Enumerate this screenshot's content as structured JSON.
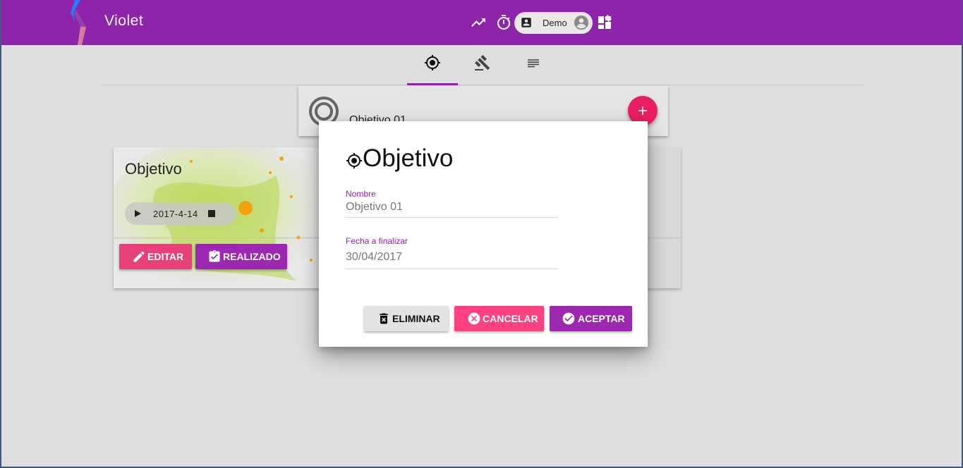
{
  "app": {
    "title": "Violet"
  },
  "user": {
    "name": "Demo"
  },
  "header_icons": [
    "trending-up-icon",
    "timer-icon",
    "contact-icon",
    "avatar-icon",
    "dashboard-icon"
  ],
  "tabs": [
    {
      "icon": "target-icon",
      "active": true
    },
    {
      "icon": "gavel-icon",
      "active": false
    },
    {
      "icon": "notes-icon",
      "active": false
    }
  ],
  "objective_header": {
    "label": "Objetivo 01"
  },
  "objective_card": {
    "title": "Objetivo",
    "timer_date": "2017-4-14",
    "edit_label": "EDITAR",
    "done_label": "REALIZADO"
  },
  "dialog": {
    "title": "Objetivo",
    "fields": [
      {
        "label": "Nombre",
        "value": "Objetivo 01"
      },
      {
        "label": "Fecha a finalizar",
        "value": "30/04/2017"
      }
    ],
    "buttons": {
      "delete": "ELIMINAR",
      "cancel": "CANCELAR",
      "accept": "ACEPTAR"
    }
  },
  "colors": {
    "primary": "#8e24aa",
    "accent": "#e91e63",
    "cancel": "#ff4081",
    "background": "#dedede"
  }
}
